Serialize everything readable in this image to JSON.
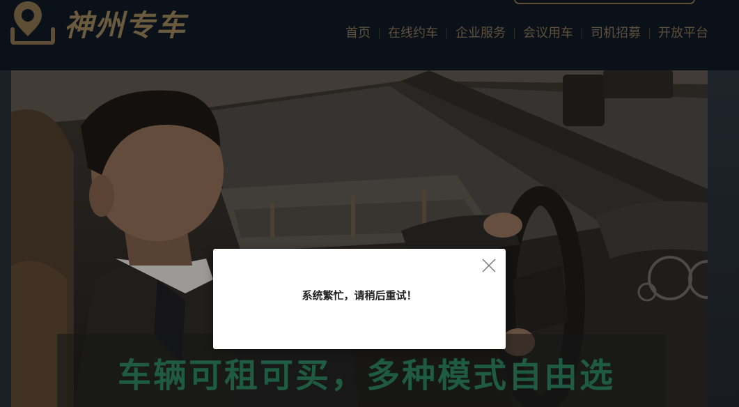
{
  "brand": {
    "name": "神州专车",
    "color": "#6a5a3e"
  },
  "nav": {
    "items": [
      {
        "label": "首页"
      },
      {
        "label": "在线约车"
      },
      {
        "label": "企业服务"
      },
      {
        "label": "会议用车"
      },
      {
        "label": "司机招募"
      },
      {
        "label": "开放平台"
      }
    ]
  },
  "hero": {
    "slogan": "车辆可租可买，多种模式自由选",
    "slogan_color": "#1f5a45"
  },
  "modal": {
    "message": "系统繁忙，请稍后重试！",
    "close_icon": "close-icon"
  }
}
